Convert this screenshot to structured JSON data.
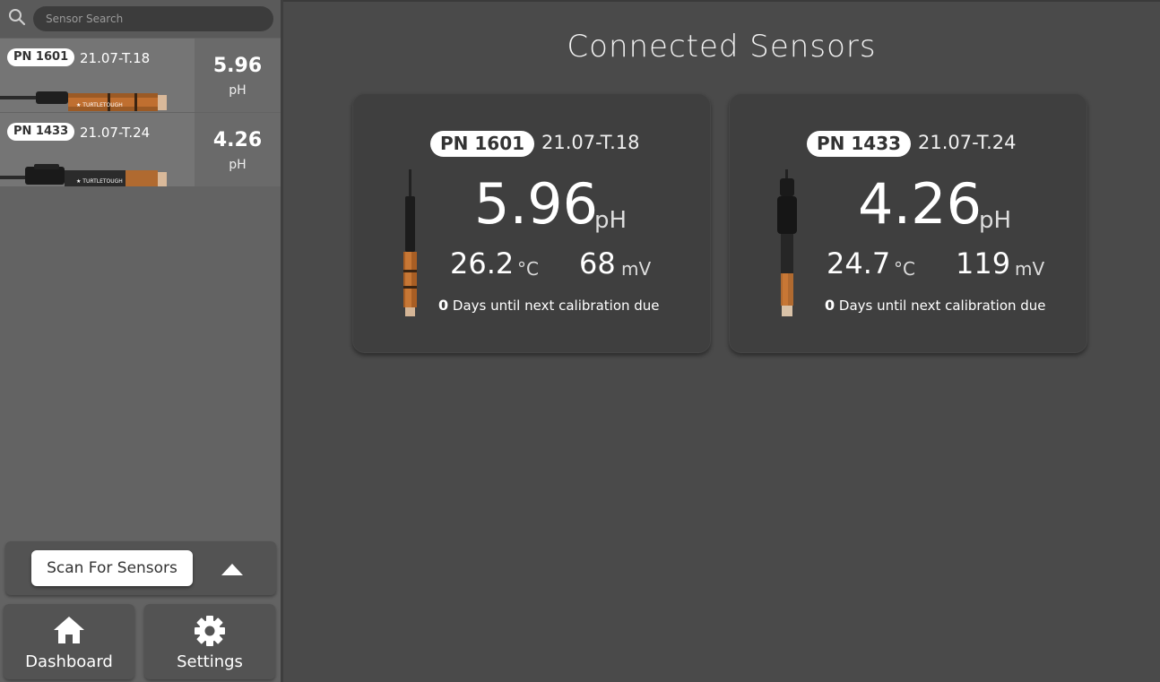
{
  "search": {
    "placeholder": "Sensor Search"
  },
  "sidebar": {
    "sensors": [
      {
        "pn": "PN 1601",
        "serial": "21.07-T.18",
        "value": "5.96",
        "unit": "pH"
      },
      {
        "pn": "PN 1433",
        "serial": "21.07-T.24",
        "value": "4.26",
        "unit": "pH"
      }
    ],
    "scan_label": "Scan For Sensors",
    "nav": {
      "dashboard_label": "Dashboard",
      "settings_label": "Settings"
    }
  },
  "main": {
    "title": "Connected Sensors",
    "cards": [
      {
        "pn": "PN 1601",
        "serial": "21.07-T.18",
        "ph": "5.96",
        "ph_unit": "pH",
        "temp": "26.2",
        "temp_unit": "°C",
        "mv": "68",
        "mv_unit": "mV",
        "cal_days": "0",
        "cal_text": "Days until next calibration due"
      },
      {
        "pn": "PN 1433",
        "serial": "21.07-T.24",
        "ph": "4.26",
        "ph_unit": "pH",
        "temp": "24.7",
        "temp_unit": "°C",
        "mv": "119",
        "mv_unit": "mV",
        "cal_days": "0",
        "cal_text": "Days until next calibration due"
      }
    ]
  },
  "icons": {
    "search": "search-icon",
    "expand": "chevron-up-icon",
    "home": "home-icon",
    "settings": "gear-icon"
  },
  "colors": {
    "background": "#4a4a4a",
    "sidebar": "#636363",
    "card": "#3f3f3f",
    "probe_orange": "#b5651d"
  }
}
